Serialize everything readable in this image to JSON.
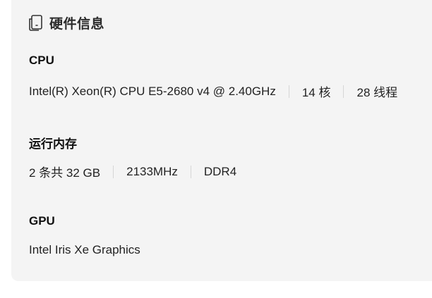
{
  "header": {
    "title": "硬件信息",
    "icon": "device-icon"
  },
  "cpu": {
    "label": "CPU",
    "model": "Intel(R) Xeon(R) CPU E5-2680 v4 @ 2.40GHz",
    "cores": "14 核",
    "threads": "28 线程"
  },
  "memory": {
    "label": "运行内存",
    "config": "2 条共 32 GB",
    "speed": "2133MHz",
    "type": "DDR4"
  },
  "gpu": {
    "label": "GPU",
    "name": "Intel Iris Xe Graphics"
  }
}
